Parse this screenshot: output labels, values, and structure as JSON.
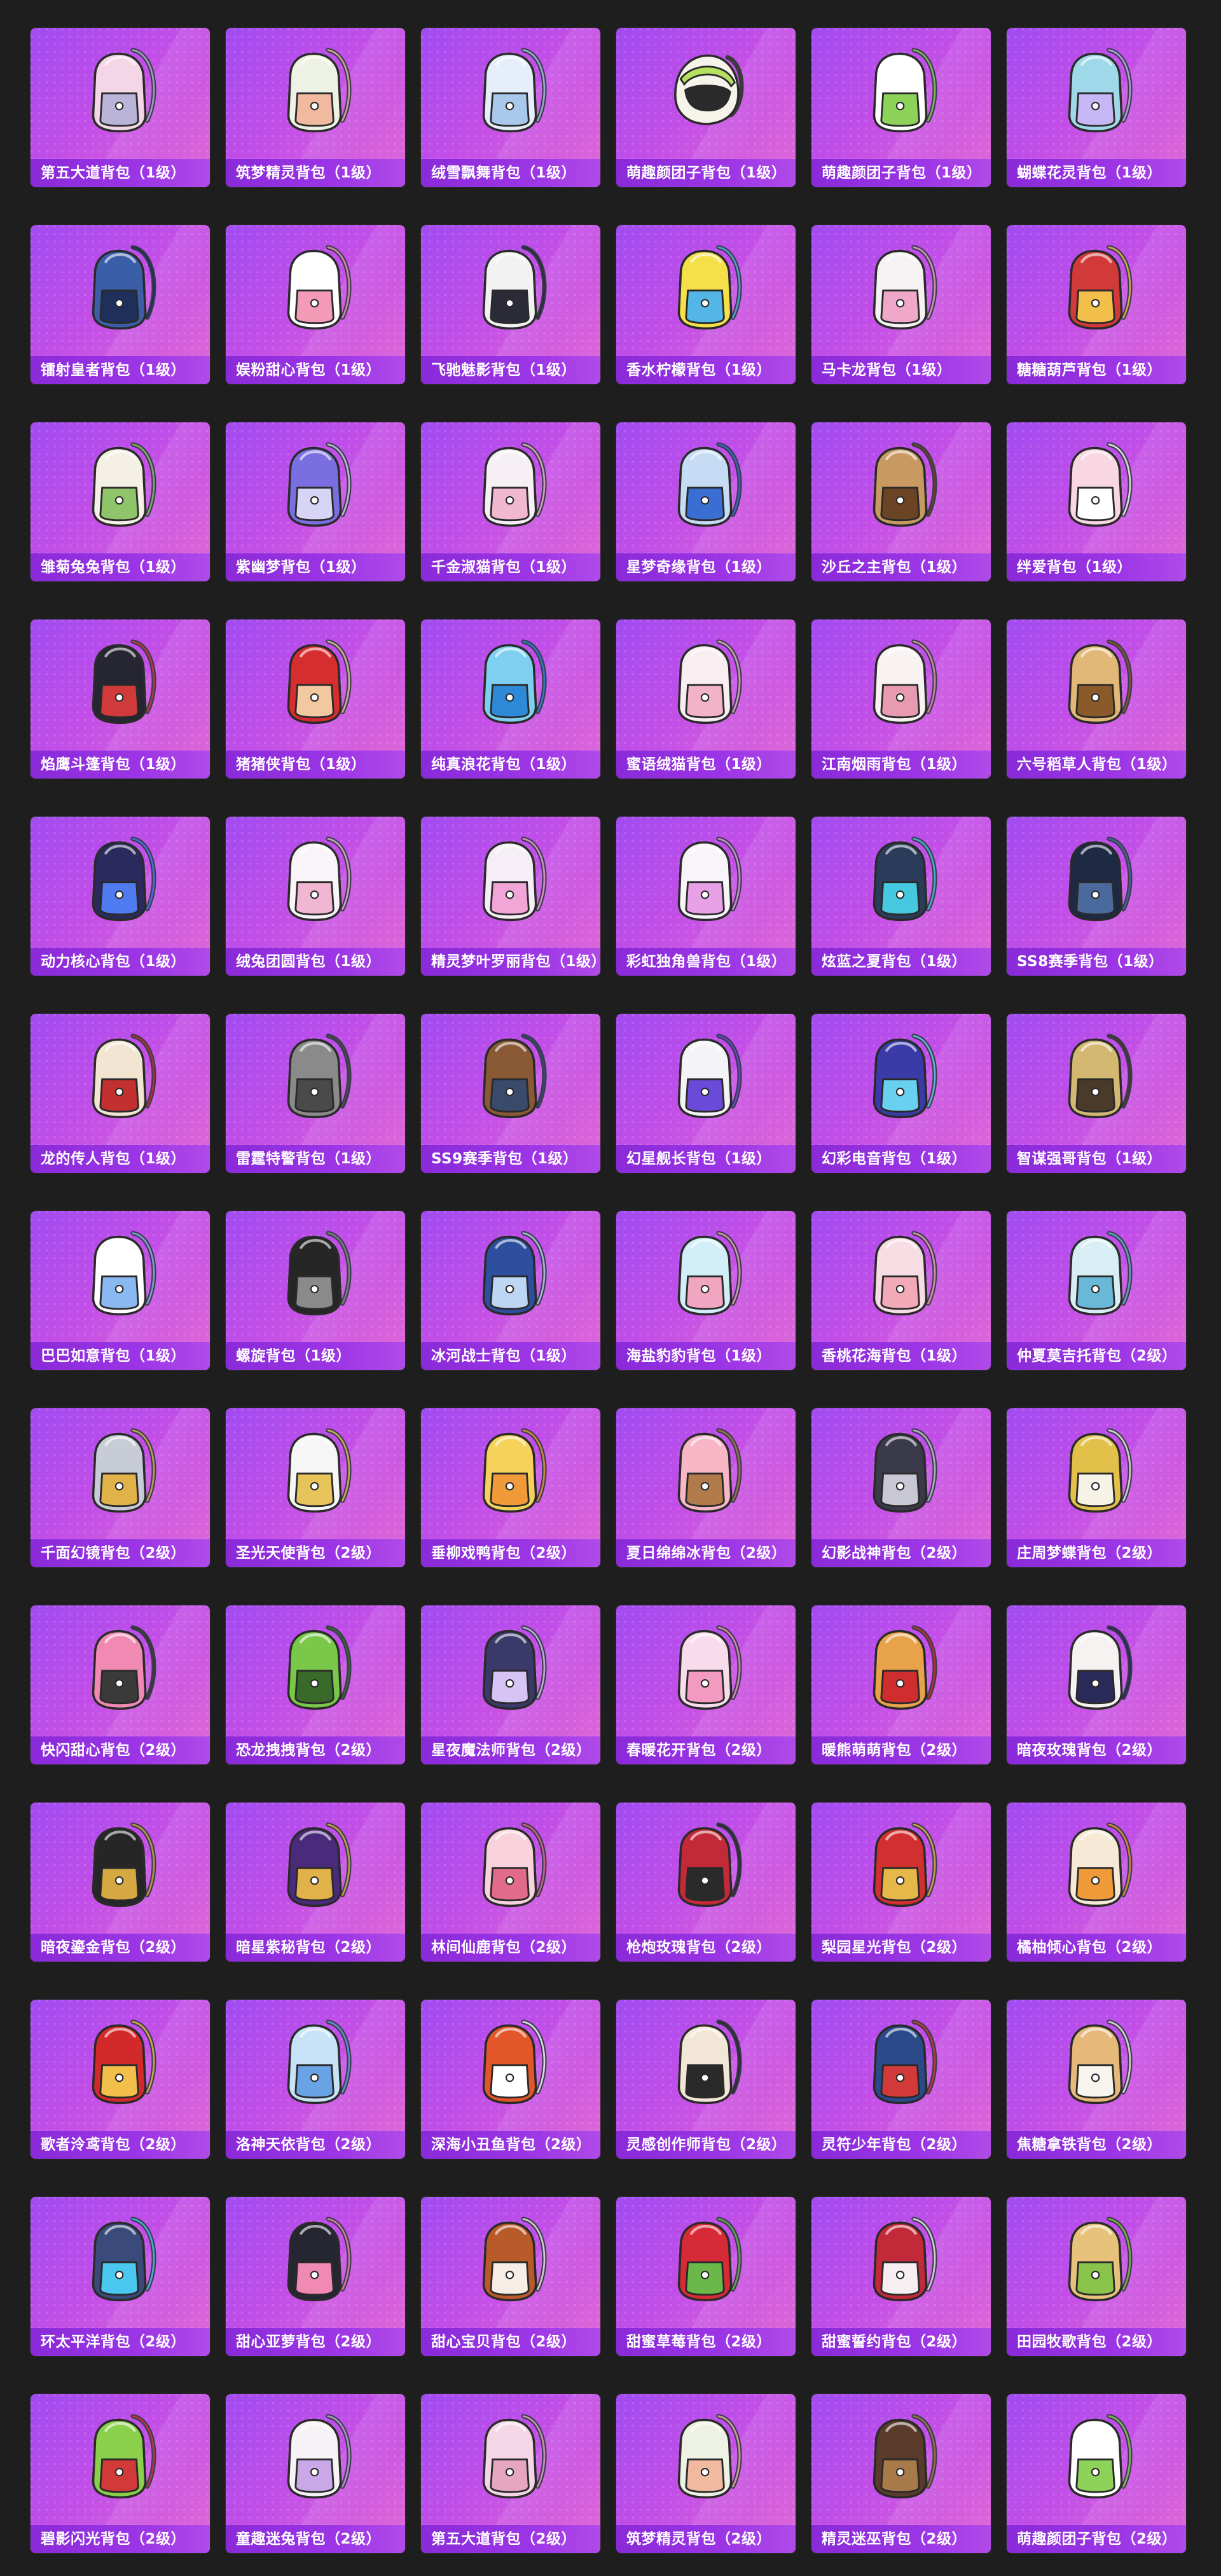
{
  "items": [
    {
      "name": "第五大道背包（1级）",
      "icon": "backpack-icon",
      "color": "#f4d6e6",
      "accent": "#b9b4d8"
    },
    {
      "name": "筑梦精灵背包（1级）",
      "icon": "backpack-icon",
      "color": "#eef2e4",
      "accent": "#f0b9a0"
    },
    {
      "name": "绒雪飘舞背包（1级）",
      "icon": "backpack-icon",
      "color": "#e6eefa",
      "accent": "#a8c8ec"
    },
    {
      "name": "萌趣颜团子背包（1级）",
      "icon": "helmet-backpack-icon",
      "color": "#f6f4ea",
      "accent": "#b6e060"
    },
    {
      "name": "萌趣颜团子背包（1级）",
      "icon": "backpack-icon",
      "color": "#ffffff",
      "accent": "#8dd35a"
    },
    {
      "name": "蝴蝶花灵背包（1级）",
      "icon": "backpack-icon",
      "color": "#9fd8e8",
      "accent": "#c6b8f4"
    },
    {
      "name": "镭射皇者背包（1级）",
      "icon": "backpack-icon",
      "color": "#3b5ea8",
      "accent": "#1d2f5a"
    },
    {
      "name": "娱粉甜心背包（1级）",
      "icon": "backpack-icon",
      "color": "#ffffff",
      "accent": "#f29ab6"
    },
    {
      "name": "飞驰魅影背包（1级）",
      "icon": "backpack-icon",
      "color": "#f2f2f2",
      "accent": "#2b2b38"
    },
    {
      "name": "香水柠檬背包（1级）",
      "icon": "backpack-icon",
      "color": "#f6e04a",
      "accent": "#54b6e6"
    },
    {
      "name": "马卡龙背包（1级）",
      "icon": "backpack-icon",
      "color": "#f6f2f4",
      "accent": "#f0a8c8"
    },
    {
      "name": "糖糖葫芦背包（1级）",
      "icon": "backpack-icon",
      "color": "#d23a3a",
      "accent": "#f2c04a"
    },
    {
      "name": "雏菊兔兔背包（1级）",
      "icon": "backpack-icon",
      "color": "#f4f0e6",
      "accent": "#8fc46a"
    },
    {
      "name": "紫幽梦背包（1级）",
      "icon": "backpack-icon",
      "color": "#7a6ee0",
      "accent": "#d8d4f6"
    },
    {
      "name": "千金淑猫背包（1级）",
      "icon": "backpack-icon",
      "color": "#f6f0f4",
      "accent": "#f2b8d0"
    },
    {
      "name": "星梦奇缘背包（1级）",
      "icon": "backpack-icon",
      "color": "#c6dcf4",
      "accent": "#3b6ed2"
    },
    {
      "name": "沙丘之主背包（1级）",
      "icon": "backpack-icon",
      "color": "#c89a62",
      "accent": "#6a4424"
    },
    {
      "name": "绊爱背包（1级）",
      "icon": "backpack-icon",
      "color": "#f8d6e2",
      "accent": "#ffffff"
    },
    {
      "name": "焰鹰斗篷背包（1级）",
      "icon": "backpack-icon",
      "color": "#262633",
      "accent": "#d03a3a"
    },
    {
      "name": "猪猪侠背包（1级）",
      "icon": "backpack-icon",
      "color": "#d62e2e",
      "accent": "#f2c8a0"
    },
    {
      "name": "纯真浪花背包（1级）",
      "icon": "backpack-icon",
      "color": "#7fd0f0",
      "accent": "#2c8ad8"
    },
    {
      "name": "蜜语绒猫背包（1级）",
      "icon": "backpack-icon",
      "color": "#f8eef2",
      "accent": "#f2b2c8"
    },
    {
      "name": "江南烟雨背包（1级）",
      "icon": "backpack-icon",
      "color": "#f8f2f2",
      "accent": "#e89ab0"
    },
    {
      "name": "六号稻草人背包（1级）",
      "icon": "backpack-icon",
      "color": "#e2b878",
      "accent": "#8a5a2a"
    },
    {
      "name": "动力核心背包（1级）",
      "icon": "backpack-icon",
      "color": "#2a2a5e",
      "accent": "#4f7af0"
    },
    {
      "name": "绒兔团圆背包（1级）",
      "icon": "backpack-icon",
      "color": "#f8f4f8",
      "accent": "#f0b6d2"
    },
    {
      "name": "精灵梦叶罗丽背包（1级）",
      "icon": "backpack-icon",
      "color": "#f6eef6",
      "accent": "#f2a6d8"
    },
    {
      "name": "彩虹独角兽背包（1级）",
      "icon": "backpack-icon",
      "color": "#f8f4fa",
      "accent": "#e8a0e6"
    },
    {
      "name": "炫蓝之夏背包（1级）",
      "icon": "backpack-icon",
      "color": "#2a3c5a",
      "accent": "#46c8e0"
    },
    {
      "name": "SS8赛季背包（1级）",
      "icon": "backpack-icon",
      "color": "#1e2a44",
      "accent": "#4a6a9e"
    },
    {
      "name": "龙的传人背包（1级）",
      "icon": "backpack-icon",
      "color": "#f2e6d2",
      "accent": "#c43030"
    },
    {
      "name": "雷霆特警背包（1级）",
      "icon": "backpack-icon",
      "color": "#8a8a8a",
      "accent": "#4a4a4a"
    },
    {
      "name": "SS9赛季背包（1级）",
      "icon": "backpack-icon",
      "color": "#8a5a36",
      "accent": "#3a4a6a"
    },
    {
      "name": "幻星舰长背包（1级）",
      "icon": "backpack-icon",
      "color": "#f4f4f8",
      "accent": "#6a4ad8"
    },
    {
      "name": "幻彩电音背包（1级）",
      "icon": "backpack-icon",
      "color": "#3a3aa8",
      "accent": "#6ad0f0"
    },
    {
      "name": "智谋强哥背包（1级）",
      "icon": "backpack-icon",
      "color": "#d2b870",
      "accent": "#4a3a2a"
    },
    {
      "name": "巴巴如意背包（1级）",
      "icon": "backpack-icon",
      "color": "#ffffff",
      "accent": "#8ab8f0"
    },
    {
      "name": "螺旋背包（1级）",
      "icon": "backpack-icon",
      "color": "#262626",
      "accent": "#8a8a8a"
    },
    {
      "name": "冰河战士背包（1级）",
      "icon": "backpack-icon",
      "color": "#2e4e9e",
      "accent": "#bcd6f4"
    },
    {
      "name": "海盐豹豹背包（1级）",
      "icon": "backpack-icon",
      "color": "#d2eef8",
      "accent": "#f0a6c0"
    },
    {
      "name": "香桃花海背包（1级）",
      "icon": "backpack-icon",
      "color": "#f8dce4",
      "accent": "#f2aab8"
    },
    {
      "name": "仲夏莫吉托背包（2级）",
      "icon": "backpack-icon",
      "color": "#d6eef4",
      "accent": "#6ab8d8"
    },
    {
      "name": "千面幻镜背包（2级）",
      "icon": "backpack-icon",
      "color": "#c8ccd6",
      "accent": "#e2b24a"
    },
    {
      "name": "圣光天使背包（2级）",
      "icon": "backpack-icon",
      "color": "#f6f6f6",
      "accent": "#e6c45a"
    },
    {
      "name": "垂柳戏鸭背包（2级）",
      "icon": "backpack-icon",
      "color": "#f6d25a",
      "accent": "#f09a3a"
    },
    {
      "name": "夏日绵绵冰背包（2级）",
      "icon": "backpack-icon",
      "color": "#f8b6c6",
      "accent": "#b07a4a"
    },
    {
      "name": "幻影战神背包（2级）",
      "icon": "backpack-icon",
      "color": "#3a3a4a",
      "accent": "#c8c8d4"
    },
    {
      "name": "庄周梦蝶背包（2级）",
      "icon": "backpack-icon",
      "color": "#e2c04a",
      "accent": "#f6f2e6"
    },
    {
      "name": "快闪甜心背包（2级）",
      "icon": "backpack-icon",
      "color": "#f08ab2",
      "accent": "#3a3a3a"
    },
    {
      "name": "恐龙拽拽背包（2级）",
      "icon": "backpack-icon",
      "color": "#7ac84a",
      "accent": "#3a6a2a"
    },
    {
      "name": "星夜魔法师背包（2级）",
      "icon": "backpack-icon",
      "color": "#3a3a6a",
      "accent": "#d6c4f4"
    },
    {
      "name": "春暖花开背包（2级）",
      "icon": "backpack-icon",
      "color": "#f8dcec",
      "accent": "#f29ac0"
    },
    {
      "name": "暖熊萌萌背包（2级）",
      "icon": "backpack-icon",
      "color": "#e8a24a",
      "accent": "#d02e2e"
    },
    {
      "name": "暗夜玫瑰背包（2级）",
      "icon": "backpack-icon",
      "color": "#f6f2f2",
      "accent": "#2a2a5a"
    },
    {
      "name": "暗夜鎏金背包（2级）",
      "icon": "backpack-icon",
      "color": "#262626",
      "accent": "#d6a842"
    },
    {
      "name": "暗星紫秘背包（2级）",
      "icon": "backpack-icon",
      "color": "#4a2a7a",
      "accent": "#e2b24a"
    },
    {
      "name": "林间仙鹿背包（2级）",
      "icon": "backpack-icon",
      "color": "#f8d2dc",
      "accent": "#e26a8a"
    },
    {
      "name": "枪炮玫瑰背包（2级）",
      "icon": "backpack-icon",
      "color": "#c22a3a",
      "accent": "#2a2a2a"
    },
    {
      "name": "梨园星光背包（2级）",
      "icon": "backpack-icon",
      "color": "#d23030",
      "accent": "#e6b84a"
    },
    {
      "name": "橘柚倾心背包（2级）",
      "icon": "backpack-icon",
      "color": "#f6ead6",
      "accent": "#f09a3a"
    },
    {
      "name": "歌者泠鸢背包（2级）",
      "icon": "backpack-icon",
      "color": "#d22a2a",
      "accent": "#f2c04a"
    },
    {
      "name": "洛神天依背包（2级）",
      "icon": "backpack-icon",
      "color": "#c8e2f8",
      "accent": "#6aa2e6"
    },
    {
      "name": "深海小丑鱼背包（2级）",
      "icon": "backpack-icon",
      "color": "#e2562a",
      "accent": "#ffffff"
    },
    {
      "name": "灵感创作师背包（2级）",
      "icon": "backpack-icon",
      "color": "#f2e6d6",
      "accent": "#2a2a2a"
    },
    {
      "name": "灵符少年背包（2级）",
      "icon": "backpack-icon",
      "color": "#2a4a8a",
      "accent": "#d23a3a"
    },
    {
      "name": "焦糖拿铁背包（2级）",
      "icon": "backpack-icon",
      "color": "#e6b87a",
      "accent": "#f8f4ee"
    },
    {
      "name": "环太平洋背包（2级）",
      "icon": "backpack-icon",
      "color": "#3a4a7a",
      "accent": "#4ac8f0"
    },
    {
      "name": "甜心亚萝背包（2级）",
      "icon": "backpack-icon",
      "color": "#262633",
      "accent": "#f08ab2"
    },
    {
      "name": "甜心宝贝背包（2级）",
      "icon": "backpack-icon",
      "color": "#b85a2a",
      "accent": "#f6eee6"
    },
    {
      "name": "甜蜜草莓背包（2级）",
      "icon": "backpack-icon",
      "color": "#d62a36",
      "accent": "#6ab84a"
    },
    {
      "name": "甜蜜誓约背包（2级）",
      "icon": "backpack-icon",
      "color": "#c22a3a",
      "accent": "#f6eef0"
    },
    {
      "name": "田园牧歌背包（2级）",
      "icon": "backpack-icon",
      "color": "#e6c27a",
      "accent": "#8ac44a"
    },
    {
      "name": "碧影闪光背包（2级）",
      "icon": "backpack-icon",
      "color": "#8ad04a",
      "accent": "#d23a3a"
    },
    {
      "name": "童趣迷兔背包（2级）",
      "icon": "backpack-icon",
      "color": "#f6f2f6",
      "accent": "#c8a8e6"
    },
    {
      "name": "第五大道背包（2级）",
      "icon": "backpack-icon",
      "color": "#f4d6e6",
      "accent": "#e6a6c0"
    },
    {
      "name": "筑梦精灵背包（2级）",
      "icon": "backpack-icon",
      "color": "#eef2e4",
      "accent": "#f0b9a0"
    },
    {
      "name": "精灵迷巫背包（2级）",
      "icon": "backpack-icon",
      "color": "#5a3a2a",
      "accent": "#a87a4a"
    },
    {
      "name": "萌趣颜团子背包（2级）",
      "icon": "backpack-icon",
      "color": "#ffffff",
      "accent": "#8dd35a"
    }
  ]
}
